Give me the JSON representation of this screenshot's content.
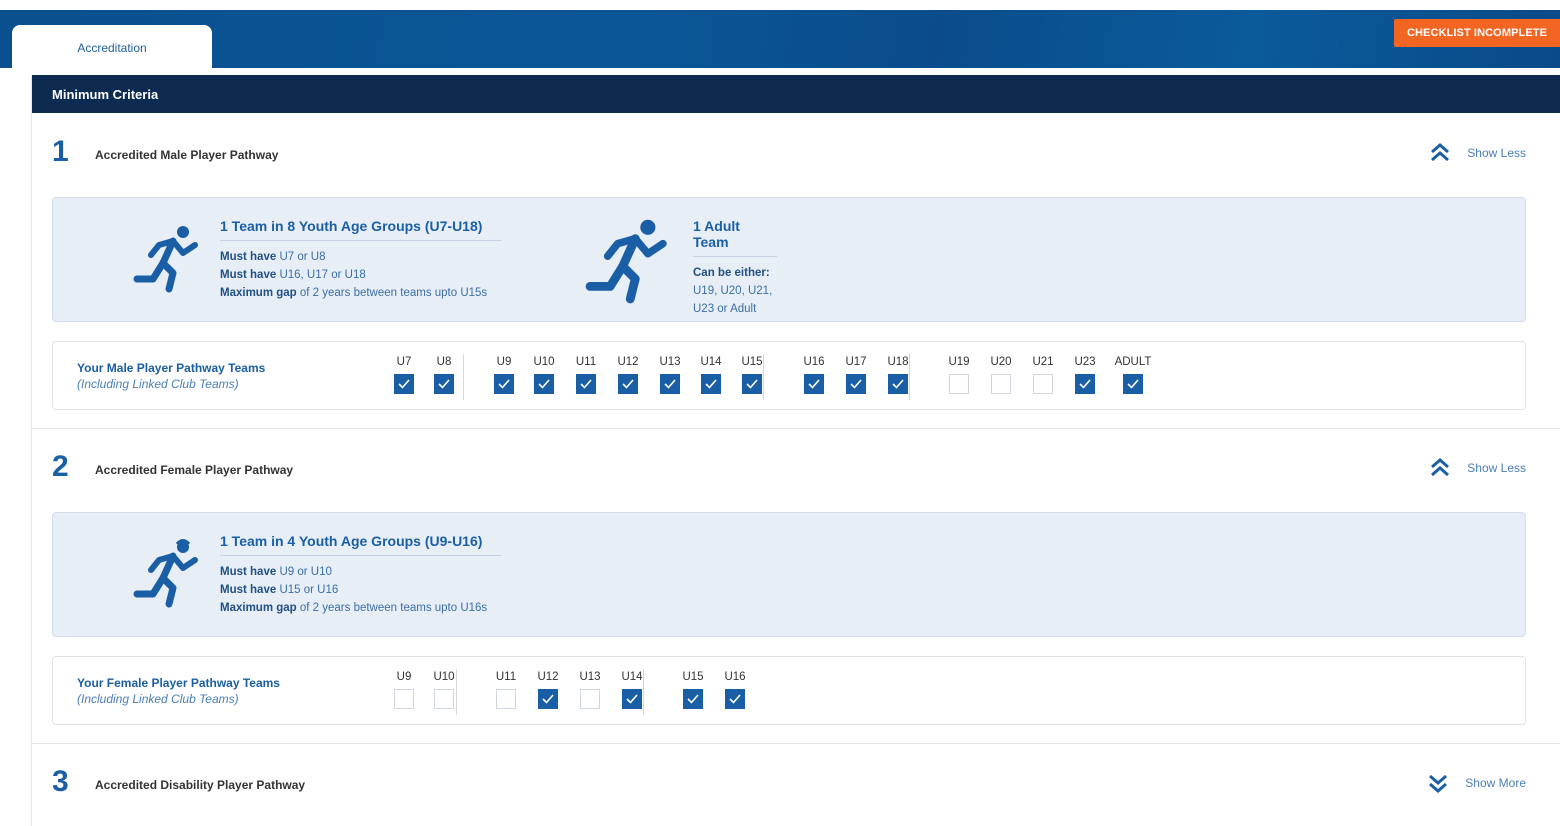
{
  "tab": {
    "label": "Accreditation"
  },
  "status_badge": {
    "label": "CHECKLIST INCOMPLETE",
    "color": "#f26522"
  },
  "panel": {
    "title": "Minimum Criteria"
  },
  "sections": [
    {
      "number": "1",
      "title": "Accredited Male Player Pathway",
      "toggle": "Show Less",
      "toggle_icon": "chevrons-up-icon",
      "criteria": [
        {
          "title": "1 Team in 8 Youth Age Groups (U7-U18)",
          "lines": [
            {
              "bold": "Must have",
              "text": " U7 or U8"
            },
            {
              "bold": "Must have",
              "text": " U16, U17 or U18"
            },
            {
              "bold": "Maximum gap",
              "text": " of 2 years between teams upto U15s"
            }
          ]
        },
        {
          "title": "1 Adult Team",
          "lines": [
            {
              "bold": "Can be either:",
              "text": ""
            },
            {
              "bold": "",
              "text": "U19, U20, U21,"
            },
            {
              "bold": "",
              "text": "U23 or Adult"
            }
          ]
        }
      ],
      "teams_label": "Your Male Player Pathway Teams",
      "teams_sublabel": "(Including Linked Club Teams)",
      "teams": [
        {
          "age": "U7",
          "checked": true
        },
        {
          "age": "U8",
          "checked": true
        },
        {
          "age": "U9",
          "checked": true
        },
        {
          "age": "U10",
          "checked": true
        },
        {
          "age": "U11",
          "checked": true
        },
        {
          "age": "U12",
          "checked": true
        },
        {
          "age": "U13",
          "checked": true
        },
        {
          "age": "U14",
          "checked": true
        },
        {
          "age": "U15",
          "checked": true
        },
        {
          "age": "U16",
          "checked": true
        },
        {
          "age": "U17",
          "checked": true
        },
        {
          "age": "U18",
          "checked": true
        },
        {
          "age": "U19",
          "checked": false
        },
        {
          "age": "U20",
          "checked": false
        },
        {
          "age": "U21",
          "checked": false
        },
        {
          "age": "U23",
          "checked": true
        },
        {
          "age": "ADULT",
          "checked": true
        }
      ]
    },
    {
      "number": "2",
      "title": "Accredited Female Player Pathway",
      "toggle": "Show Less",
      "toggle_icon": "chevrons-up-icon",
      "criteria": [
        {
          "title": "1 Team in 4 Youth Age Groups (U9-U16)",
          "lines": [
            {
              "bold": "Must have",
              "text": " U9 or U10"
            },
            {
              "bold": "Must have",
              "text": " U15 or U16"
            },
            {
              "bold": "Maximum gap",
              "text": " of 2 years between teams upto U16s"
            }
          ]
        }
      ],
      "teams_label": "Your Female Player Pathway Teams",
      "teams_sublabel": "(Including Linked Club Teams)",
      "teams": [
        {
          "age": "U9",
          "checked": false
        },
        {
          "age": "U10",
          "checked": false
        },
        {
          "age": "U11",
          "checked": false
        },
        {
          "age": "U12",
          "checked": true
        },
        {
          "age": "U13",
          "checked": false
        },
        {
          "age": "U14",
          "checked": true
        },
        {
          "age": "U15",
          "checked": true
        },
        {
          "age": "U16",
          "checked": true
        }
      ]
    },
    {
      "number": "3",
      "title": "Accredited Disability Player Pathway",
      "toggle": "Show More",
      "toggle_icon": "chevrons-down-icon"
    }
  ]
}
